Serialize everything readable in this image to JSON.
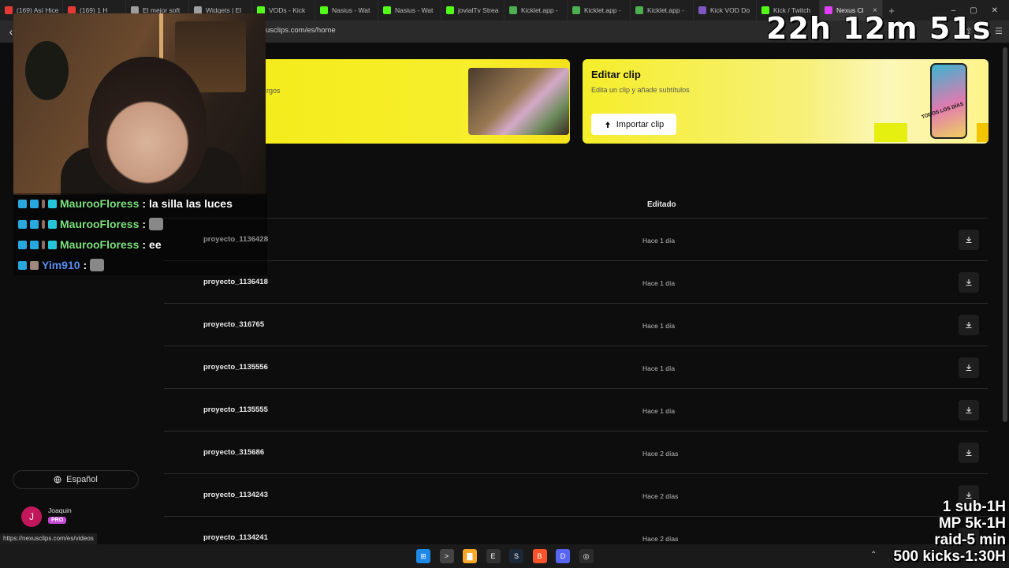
{
  "browser": {
    "tabs": [
      {
        "label": "(169) Así Hice",
        "color": "#e53935"
      },
      {
        "label": "(169) 1 H",
        "color": "#e53935"
      },
      {
        "label": "El mejor soft",
        "color": "#9e9e9e"
      },
      {
        "label": "Widgets | El",
        "color": "#9e9e9e"
      },
      {
        "label": "VODs - Kick",
        "color": "#53fc18"
      },
      {
        "label": "Nasius - Wat",
        "color": "#53fc18"
      },
      {
        "label": "Nasius - Wat",
        "color": "#53fc18"
      },
      {
        "label": "jovialTv Strea",
        "color": "#53fc18"
      },
      {
        "label": "Kicklet.app -",
        "color": "#4caf50"
      },
      {
        "label": "Kicklet.app -",
        "color": "#4caf50"
      },
      {
        "label": "Kicklet.app -",
        "color": "#4caf50"
      },
      {
        "label": "Kick VOD Do",
        "color": "#7e57c2"
      },
      {
        "label": "Kick / Twitch",
        "color": "#53fc18"
      },
      {
        "label": "Nexus Cl",
        "color": "#e040fb",
        "active": true
      }
    ],
    "url": "usclips.com/es/home",
    "status_url": "https://nexusclips.com/es/videos"
  },
  "cards": {
    "left_subtitle": "rgos",
    "right": {
      "title": "Editar clip",
      "description": "Edita un clip y añade subtítulos",
      "button_label": "Importar clip",
      "phone_tag": "TODOS LOS DÍAS"
    }
  },
  "table": {
    "column_header": "Editado",
    "rows": [
      {
        "name": "proyecto_1136428",
        "edited": "Hace 1 día"
      },
      {
        "name": "proyecto_1136418",
        "edited": "Hace 1 día"
      },
      {
        "name": "proyecto_316765",
        "edited": "Hace 1 día"
      },
      {
        "name": "proyecto_1135556",
        "edited": "Hace 1 día"
      },
      {
        "name": "proyecto_1135555",
        "edited": "Hace 1 día"
      },
      {
        "name": "proyecto_315686",
        "edited": "Hace 2 días"
      },
      {
        "name": "proyecto_1134243",
        "edited": "Hace 2 días"
      },
      {
        "name": "proyecto_1134241",
        "edited": "Hace 2 días"
      }
    ]
  },
  "sidebar": {
    "language_label": "Español",
    "user": {
      "initial": "J",
      "name": "Joaquin",
      "plan": "PRO"
    }
  },
  "overlay": {
    "timer": "22h 12m 51s",
    "chat": [
      {
        "user": "MaurooFloress",
        "sep": ":",
        "message": "la silla las luces",
        "emote": false
      },
      {
        "user": "MaurooFloress",
        "sep": ":",
        "message": "",
        "emote": true
      },
      {
        "user": "MaurooFloress",
        "sep": ":",
        "message": "ee",
        "emote": false
      },
      {
        "user": "Yim910",
        "sep": ":",
        "message": "",
        "emote": true
      }
    ],
    "goals": [
      "1 sub-1H",
      "MP 5k-1H",
      "raid-5 min",
      "500 kicks-1:30H"
    ]
  },
  "taskbar": {
    "apps": [
      {
        "name": "windows-start",
        "color": "#1e88e5",
        "glyph": "⊞"
      },
      {
        "name": "terminal",
        "color": "#444",
        "glyph": ">"
      },
      {
        "name": "file-explorer",
        "color": "#f9a825",
        "glyph": "▇"
      },
      {
        "name": "epic-games",
        "color": "#333",
        "glyph": "E"
      },
      {
        "name": "steam",
        "color": "#1b2838",
        "glyph": "S"
      },
      {
        "name": "brave",
        "color": "#fb542b",
        "glyph": "B"
      },
      {
        "name": "discord",
        "color": "#5865f2",
        "glyph": "D"
      },
      {
        "name": "obs",
        "color": "#2b2b2b",
        "glyph": "◎"
      }
    ]
  }
}
